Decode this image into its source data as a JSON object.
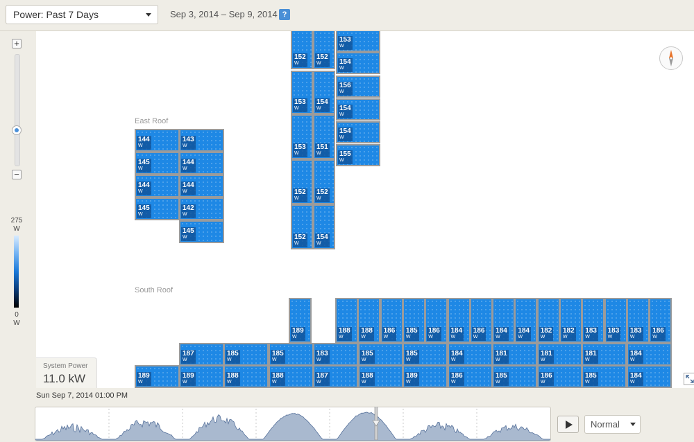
{
  "toolbar": {
    "view_select": "Power: Past 7 Days",
    "date_range": "Sep 3, 2014 – Sep 9, 2014",
    "help_label": "?"
  },
  "zoom": {
    "plus_label": "+",
    "minus_label": "−"
  },
  "legend": {
    "max_value": "275",
    "min_value": "0",
    "unit": "W"
  },
  "roofs": [
    {
      "label": "East Roof"
    },
    {
      "label": "South Roof"
    }
  ],
  "panel_unit": "W",
  "panels": [
    {
      "value": "152"
    },
    {
      "value": "152"
    },
    {
      "value": "153"
    },
    {
      "value": "154"
    },
    {
      "value": "154"
    },
    {
      "value": "156"
    },
    {
      "value": "153"
    },
    {
      "value": "151"
    },
    {
      "value": "154"
    },
    {
      "value": "155"
    },
    {
      "value": "154"
    },
    {
      "value": "152"
    },
    {
      "value": "152"
    },
    {
      "value": "152"
    },
    {
      "value": "154"
    },
    {
      "value": "144"
    },
    {
      "value": "143"
    },
    {
      "value": "145"
    },
    {
      "value": "144"
    },
    {
      "value": "144"
    },
    {
      "value": "144"
    },
    {
      "value": "145"
    },
    {
      "value": "142"
    },
    {
      "value": "145"
    },
    {
      "value": "189"
    },
    {
      "value": "188"
    },
    {
      "value": "188"
    },
    {
      "value": "186"
    },
    {
      "value": "185"
    },
    {
      "value": "186"
    },
    {
      "value": "184"
    },
    {
      "value": "186"
    },
    {
      "value": "184"
    },
    {
      "value": "184"
    },
    {
      "value": "182"
    },
    {
      "value": "182"
    },
    {
      "value": "183"
    },
    {
      "value": "183"
    },
    {
      "value": "183"
    },
    {
      "value": "186"
    },
    {
      "value": "187"
    },
    {
      "value": "185"
    },
    {
      "value": "185"
    },
    {
      "value": "183"
    },
    {
      "value": "185"
    },
    {
      "value": "185"
    },
    {
      "value": "184"
    },
    {
      "value": "181"
    },
    {
      "value": "181"
    },
    {
      "value": "181"
    },
    {
      "value": "184"
    },
    {
      "value": "189"
    },
    {
      "value": "189"
    },
    {
      "value": "188"
    },
    {
      "value": "188"
    },
    {
      "value": "187"
    },
    {
      "value": "188"
    },
    {
      "value": "189"
    },
    {
      "value": "186"
    },
    {
      "value": "185"
    },
    {
      "value": "186"
    },
    {
      "value": "185"
    },
    {
      "value": "184"
    }
  ],
  "system_power": {
    "label": "System Power",
    "value": "11.0 kW"
  },
  "playback": {
    "timestamp": "Sun Sep 7, 2014 01:00 PM",
    "speed": "Normal",
    "position_fraction": 0.66
  },
  "colors": {
    "panel": "#1e88e5",
    "panel_border": "#9b9b9b",
    "timeline_fill": "#a9b9cf",
    "timeline_line": "#55709a"
  },
  "icons": {
    "compass": "compass-icon",
    "expand": "expand-icon",
    "play": "play-icon",
    "help": "help-icon"
  }
}
